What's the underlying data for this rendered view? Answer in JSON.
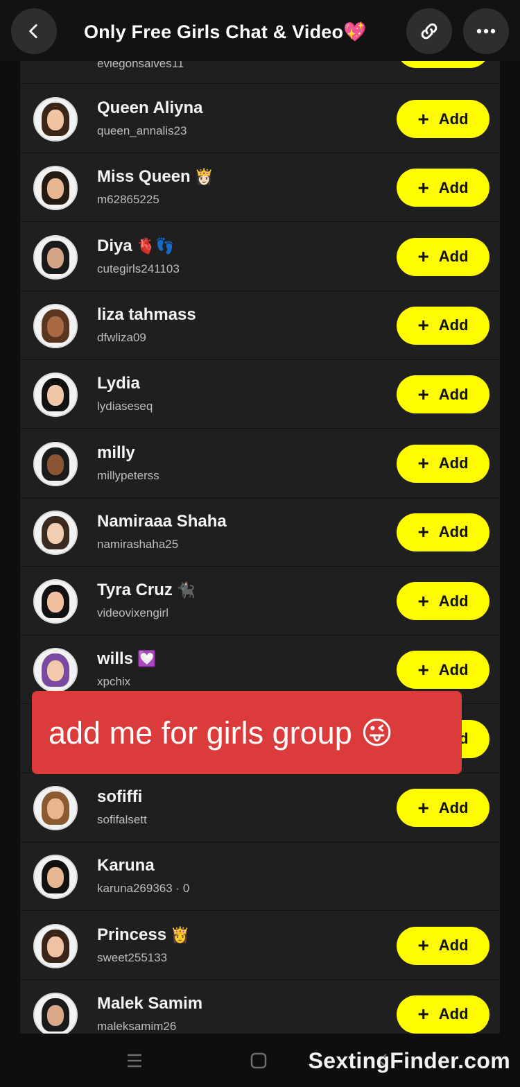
{
  "header": {
    "title": "Only Free Girls Chat & Video💖",
    "back_icon": "chevron-left-icon",
    "link_icon": "link-icon",
    "more_icon": "more-horizontal-icon"
  },
  "partial_top_row": {
    "username": "eviegonsalves11"
  },
  "members": [
    {
      "name": "Queen Aliyna",
      "emoji": "",
      "username": "queen_annalis23",
      "button": "Add",
      "hair": "#3b2418",
      "skin": "#f2c3a3"
    },
    {
      "name": "Miss Queen",
      "emoji": "👸🏻",
      "username": "m62865225",
      "button": "Add",
      "hair": "#241a14",
      "skin": "#e8b895"
    },
    {
      "name": "Diya",
      "emoji": "🫀👣",
      "username": "cutegirls241103",
      "button": "Add",
      "hair": "#1a1a1a",
      "skin": "#d5a587"
    },
    {
      "name": "liza tahmass",
      "emoji": "",
      "username": "dfwliza09",
      "button": "Add",
      "hair": "#5a3520",
      "skin": "#a86a45"
    },
    {
      "name": "Lydia",
      "emoji": "",
      "username": "lydiaseseq",
      "button": "Add",
      "hair": "#111111",
      "skin": "#f0c6a8"
    },
    {
      "name": "milly",
      "emoji": "",
      "username": "millypeterss",
      "button": "Add",
      "hair": "#1c1c1c",
      "skin": "#8a5535"
    },
    {
      "name": "Namiraaa Shaha",
      "emoji": "",
      "username": "namirashaha25",
      "button": "Add",
      "hair": "#3a2a20",
      "skin": "#f1cdb4"
    },
    {
      "name": "Tyra Cruz",
      "emoji": "🐈‍⬛",
      "username": "videovixengirl",
      "button": "Add",
      "hair": "#111111",
      "skin": "#f0c0a0"
    },
    {
      "name": "wills",
      "emoji": "💟",
      "username": "xpchix",
      "button": "Add",
      "hair": "#7a4aa0",
      "skin": "#f3c9ae"
    },
    {
      "name": "",
      "emoji": "",
      "username": "",
      "button": "Add",
      "hair": "#333333",
      "skin": "#e0b090"
    },
    {
      "name": "sofiffi",
      "emoji": "",
      "username": "sofifalsett",
      "button": "Add",
      "hair": "#8a5a30",
      "skin": "#e7b58e"
    },
    {
      "name": "Karuna",
      "emoji": "",
      "username": "karuna269363 · 0",
      "button": "",
      "hair": "#111111",
      "skin": "#e6b693"
    },
    {
      "name": "Princess",
      "emoji": "👸",
      "username": "sweet255133",
      "button": "Add",
      "hair": "#3a2418",
      "skin": "#f0c2a4"
    },
    {
      "name": "Malek Samim",
      "emoji": "",
      "username": "maleksamim26",
      "button": "Add",
      "hair": "#1a1a1a",
      "skin": "#d9a98a"
    }
  ],
  "overlay": {
    "text": "add me for girls group 😜"
  },
  "watermark": "SextingFinder.com",
  "colors": {
    "add_button": "#fffc00",
    "list_bg": "#1f1f1f",
    "overlay_bg": "#db3b3b"
  }
}
